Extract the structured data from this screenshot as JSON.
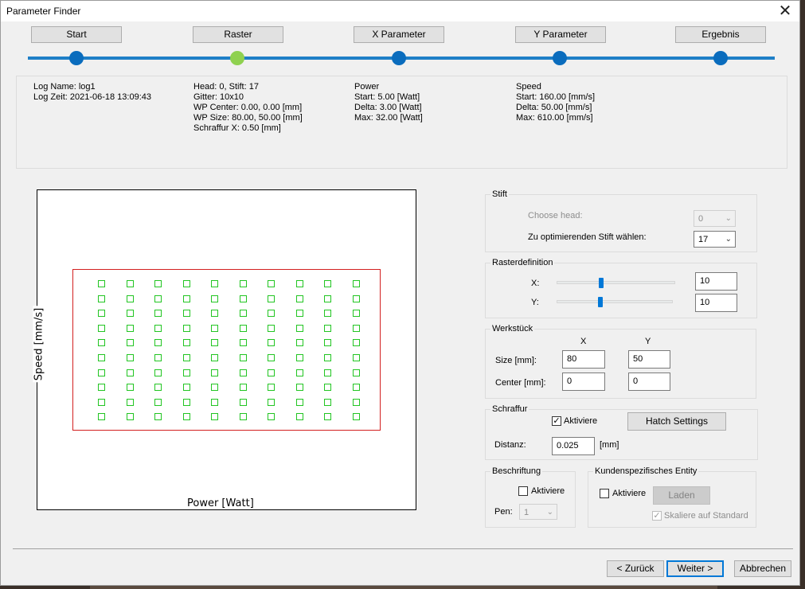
{
  "window": {
    "title": "Parameter Finder",
    "close_glyph": "✕"
  },
  "steps": [
    "Start",
    "Raster",
    "X Parameter",
    "Y Parameter",
    "Ergebnis"
  ],
  "active_step": 1,
  "info": {
    "col1": "Log Name: log1\nLog Zeit: 2021-06-18 13:09:43",
    "col2": "Head: 0, Stift: 17\nGitter: 10x10\nWP Center: 0.00, 0.00 [mm]\nWP Size: 80.00, 50.00 [mm]\nSchraffur X: 0.50 [mm]",
    "col3": "Power\nStart: 5.00 [Watt]\nDelta: 3.00 [Watt]\nMax: 32.00 [Watt]",
    "col4": "Speed\nStart: 160.00 [mm/s]\nDelta: 50.00 [mm/s]\nMax: 610.00 [mm/s]"
  },
  "plot": {
    "xlabel": "Power [Watt]",
    "ylabel": "Speed [mm/s]",
    "grid_cols": 10,
    "grid_rows": 10,
    "cell_color": "#22c522",
    "frame_color": "#d31f1f"
  },
  "stift": {
    "title": "Stift",
    "head_label": "Choose head:",
    "head_value": "0",
    "pen_label": "Zu optimierenden Stift wählen:",
    "pen_value": "17"
  },
  "raster": {
    "title": "Rasterdefinition",
    "x_label": "X:",
    "y_label": "Y:",
    "x_value": "10",
    "y_value": "10"
  },
  "werkstueck": {
    "title": "Werkstück",
    "col_x": "X",
    "col_y": "Y",
    "size_label": "Size [mm]:",
    "center_label": "Center [mm]:",
    "size_x": "80",
    "size_y": "50",
    "center_x": "0",
    "center_y": "0"
  },
  "schraffur": {
    "title": "Schraffur",
    "activate_label": "Aktiviere",
    "activated": true,
    "hatch_button": "Hatch Settings",
    "distance_label": "Distanz:",
    "distance_value": "0.025",
    "distance_unit": "[mm]"
  },
  "beschriftung": {
    "title": "Beschriftung",
    "activate_label": "Aktiviere",
    "pen_label": "Pen:",
    "pen_value": "1"
  },
  "entity": {
    "title": "Kundenspezifisches Entity",
    "activate_label": "Aktiviere",
    "load_button": "Laden",
    "scale_label": "Skaliere auf Standard"
  },
  "footer": {
    "back": "< Zurück",
    "next": "Weiter >",
    "cancel": "Abbrechen"
  }
}
